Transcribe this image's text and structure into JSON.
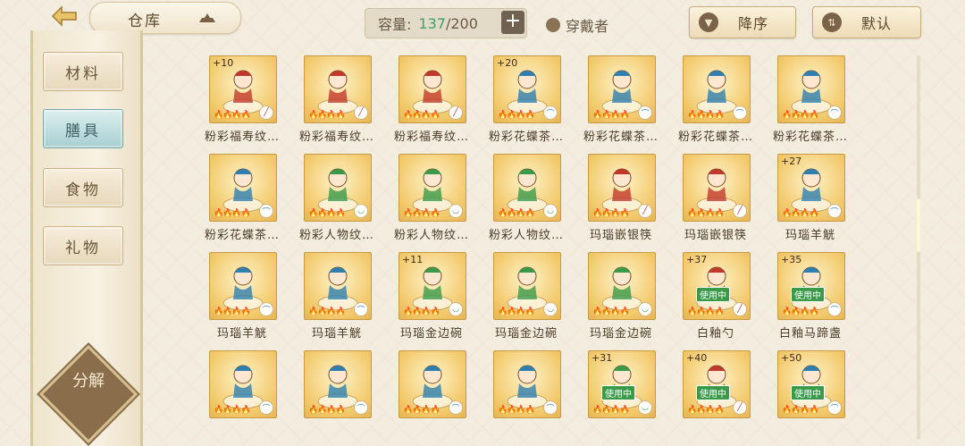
{
  "topbar": {
    "title": "仓库",
    "capacity_label": "容量:",
    "capacity_current": "137",
    "capacity_sep": "/",
    "capacity_max": "200",
    "plus": "+",
    "wear_label": "穿戴者",
    "sort_label": "降序",
    "default_label": "默认"
  },
  "sidebar": {
    "tabs": [
      {
        "label": "材料"
      },
      {
        "label": "膳具"
      },
      {
        "label": "食物"
      },
      {
        "label": "礼物"
      }
    ],
    "decompose": "分解"
  },
  "colors": {
    "accent": "#3aa36a",
    "active_tab": "#a8cfd1",
    "card": "#f2c96b"
  },
  "items": [
    {
      "count": "+10",
      "name": "粉彩福寿纹…",
      "badge": "red",
      "using": ""
    },
    {
      "count": "",
      "name": "粉彩福寿纹…",
      "badge": "red",
      "using": ""
    },
    {
      "count": "",
      "name": "粉彩福寿纹…",
      "badge": "red",
      "using": ""
    },
    {
      "count": "+20",
      "name": "粉彩花蝶茶…",
      "badge": "blue",
      "using": ""
    },
    {
      "count": "",
      "name": "粉彩花蝶茶…",
      "badge": "blue",
      "using": ""
    },
    {
      "count": "",
      "name": "粉彩花蝶茶…",
      "badge": "blue",
      "using": ""
    },
    {
      "count": "",
      "name": "粉彩花蝶茶…",
      "badge": "blue",
      "using": ""
    },
    {
      "count": "",
      "name": "粉彩花蝶茶…",
      "badge": "blue",
      "using": ""
    },
    {
      "count": "",
      "name": "粉彩人物纹…",
      "badge": "green",
      "using": ""
    },
    {
      "count": "",
      "name": "粉彩人物纹…",
      "badge": "green",
      "using": ""
    },
    {
      "count": "",
      "name": "粉彩人物纹…",
      "badge": "green",
      "using": ""
    },
    {
      "count": "",
      "name": "玛瑙嵌银筷",
      "badge": "red",
      "using": ""
    },
    {
      "count": "",
      "name": "玛瑙嵌银筷",
      "badge": "red",
      "using": ""
    },
    {
      "count": "+27",
      "name": "玛瑙羊觥",
      "badge": "blue",
      "using": ""
    },
    {
      "count": "",
      "name": "玛瑙羊觥",
      "badge": "blue",
      "using": ""
    },
    {
      "count": "",
      "name": "玛瑙羊觥",
      "badge": "blue",
      "using": ""
    },
    {
      "count": "+11",
      "name": "玛瑙金边碗",
      "badge": "green",
      "using": ""
    },
    {
      "count": "",
      "name": "玛瑙金边碗",
      "badge": "green",
      "using": ""
    },
    {
      "count": "",
      "name": "玛瑙金边碗",
      "badge": "green",
      "using": ""
    },
    {
      "count": "+37",
      "name": "白釉勺",
      "badge": "red",
      "using": "使用中"
    },
    {
      "count": "+35",
      "name": "白釉马蹄盏",
      "badge": "blue",
      "using": "使用中"
    },
    {
      "count": "",
      "name": "",
      "badge": "blue",
      "using": ""
    },
    {
      "count": "",
      "name": "",
      "badge": "blue",
      "using": ""
    },
    {
      "count": "",
      "name": "",
      "badge": "blue",
      "using": ""
    },
    {
      "count": "",
      "name": "",
      "badge": "blue",
      "using": ""
    },
    {
      "count": "+31",
      "name": "",
      "badge": "green",
      "using": "使用中"
    },
    {
      "count": "+40",
      "name": "",
      "badge": "red",
      "using": "使用中"
    },
    {
      "count": "+50",
      "name": "",
      "badge": "blue",
      "using": "使用中"
    }
  ]
}
